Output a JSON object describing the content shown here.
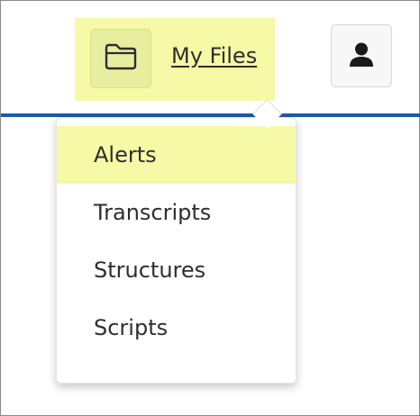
{
  "header": {
    "my_files_label": "My Files"
  },
  "icons": {
    "folder": "folder-icon",
    "user": "user-icon"
  },
  "menu": {
    "items": [
      {
        "label": "Alerts",
        "highlighted": true
      },
      {
        "label": "Transcripts",
        "highlighted": false
      },
      {
        "label": "Structures",
        "highlighted": false
      },
      {
        "label": "Scripts",
        "highlighted": false
      }
    ]
  },
  "colors": {
    "highlight": "#f6f9a5",
    "header_rule": "#1f5aa6",
    "text": "#2e2e2e"
  }
}
